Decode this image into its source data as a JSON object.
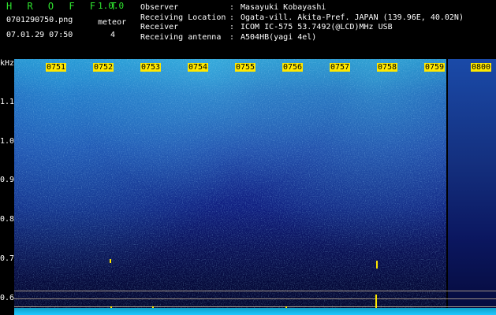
{
  "header": {
    "app_title": "H R O F F T",
    "version": "1.0.0",
    "filename": "0701290750.png",
    "datetime": "07.01.29 07:50",
    "meteor_label": "meteor",
    "meteor_count": "4"
  },
  "info": {
    "rows": [
      {
        "key": "Observer",
        "sep": ":",
        "value": "Masayuki Kobayashi"
      },
      {
        "key": "Receiving Location",
        "sep": ":",
        "value": "Ogata-vill. Akita-Pref. JAPAN (139.96E, 40.02N)"
      },
      {
        "key": "Receiver",
        "sep": ":",
        "value": "ICOM IC-575 53.7492(@LCD)MHz USB"
      },
      {
        "key": "Receiving antenna",
        "sep": ":",
        "value": "A504HB(yagi 4el)"
      }
    ]
  },
  "y_axis": {
    "unit": "kHz",
    "ticks": [
      "1.1",
      "1.0",
      "0.9",
      "0.8",
      "0.7",
      "0.6"
    ]
  },
  "time_axis": {
    "labels": [
      "0751",
      "0752",
      "0753",
      "0754",
      "0755",
      "0756",
      "0757",
      "0758",
      "0759",
      "0800"
    ]
  },
  "colors": {
    "title_green": "#2fe42f",
    "time_label_bg": "#ffe800",
    "spectrogram_top": "#1f7fc4",
    "spectrogram_bottom": "#03052a"
  }
}
